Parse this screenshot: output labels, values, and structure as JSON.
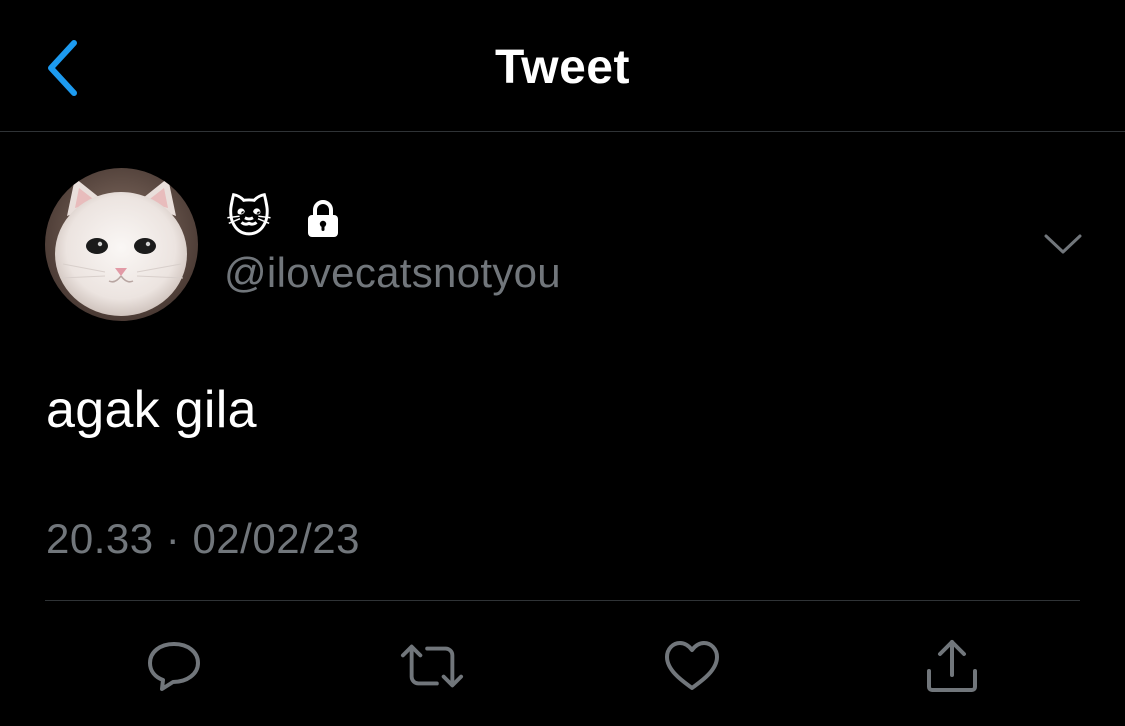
{
  "header": {
    "title": "Tweet",
    "back_icon": "chevron-left-icon",
    "accent_color": "#1d9bf0"
  },
  "tweet": {
    "author": {
      "display_name": "🐱",
      "handle": "@ilovecatsnotyou",
      "protected_icon": "lock-icon",
      "avatar": "white-cat-avatar"
    },
    "text": "agak gila",
    "time": "20.33",
    "separator": "·",
    "date": "02/02/23",
    "more_icon": "chevron-down-icon"
  },
  "actions": [
    {
      "name": "reply",
      "icon": "reply-icon"
    },
    {
      "name": "retweet",
      "icon": "retweet-icon"
    },
    {
      "name": "like",
      "icon": "heart-icon"
    },
    {
      "name": "share",
      "icon": "share-icon"
    }
  ],
  "colors": {
    "background": "#000000",
    "text": "#ffffff",
    "muted": "#71767b",
    "divider": "#2f3336"
  }
}
